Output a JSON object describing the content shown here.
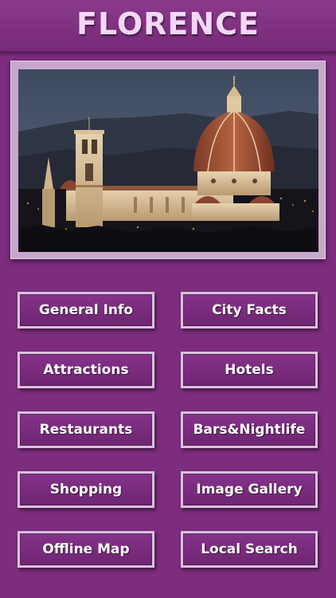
{
  "header": {
    "title": "FLORENCE"
  },
  "hero": {
    "image_subject": "florence-cathedral-dusk-photo"
  },
  "menu": {
    "buttons": [
      {
        "label": "General Info"
      },
      {
        "label": "City Facts"
      },
      {
        "label": "Attractions"
      },
      {
        "label": "Hotels"
      },
      {
        "label": "Restaurants"
      },
      {
        "label": "Bars&Nightlife"
      },
      {
        "label": "Shopping"
      },
      {
        "label": "Image Gallery"
      },
      {
        "label": "Offline Map"
      },
      {
        "label": "Local Search"
      }
    ]
  },
  "colors": {
    "background": "#7d2c7e",
    "button_border": "#d9c2dc",
    "title_text": "#f3d8f6"
  }
}
